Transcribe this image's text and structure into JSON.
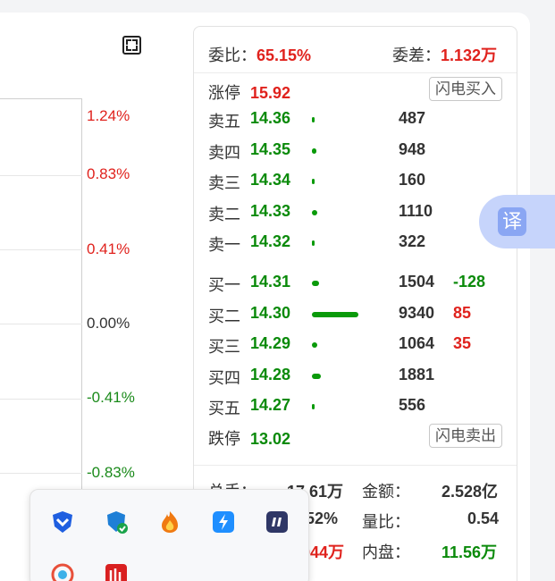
{
  "chart": {
    "pct_labels": [
      "1.24%",
      "0.83%",
      "0.41%",
      "0.00%",
      "-0.41%",
      "-0.83%"
    ]
  },
  "summary": {
    "weibi_label": "委比：",
    "weibi_value": "65.15%",
    "weicha_label": "委差：",
    "weicha_value": "1.132万"
  },
  "limit_up": {
    "label": "涨停",
    "value": "15.92",
    "button": "闪电买入"
  },
  "limit_down": {
    "label": "跌停",
    "value": "13.02",
    "button": "闪电卖出"
  },
  "asks": [
    {
      "label": "卖五",
      "price": "14.36",
      "volume": "487",
      "change": "",
      "level": 0.05
    },
    {
      "label": "卖四",
      "price": "14.35",
      "volume": "948",
      "change": "",
      "level": 0.1
    },
    {
      "label": "卖三",
      "price": "14.34",
      "volume": "160",
      "change": "",
      "level": 0.02
    },
    {
      "label": "卖二",
      "price": "14.33",
      "volume": "1110",
      "change": "",
      "level": 0.12
    },
    {
      "label": "卖一",
      "price": "14.32",
      "volume": "322",
      "change": "",
      "level": 0.03
    }
  ],
  "bids": [
    {
      "label": "买一",
      "price": "14.31",
      "volume": "1504",
      "change": "-128",
      "change_color": "#0a8a0a",
      "level": 0.16
    },
    {
      "label": "买二",
      "price": "14.30",
      "volume": "9340",
      "change": "85",
      "change_color": "#e0221d",
      "level": 1.0
    },
    {
      "label": "买三",
      "price": "14.29",
      "volume": "1064",
      "change": "35",
      "change_color": "#e0221d",
      "level": 0.11
    },
    {
      "label": "买四",
      "price": "14.28",
      "volume": "1881",
      "change": "",
      "change_color": "#333333",
      "level": 0.2
    },
    {
      "label": "买五",
      "price": "14.27",
      "volume": "556",
      "change": "",
      "change_color": "#333333",
      "level": 0.06
    }
  ],
  "stats": {
    "zongshou_label": "总手：",
    "zongshou_value": "17.61万",
    "jine_label": "金额：",
    "jine_value": "2.528亿",
    "huanshou_value": ".52%",
    "liangbi_label": "量比：",
    "liangbi_value": "0.54",
    "waipan_value": "044万",
    "neipan_label": "内盘：",
    "neipan_value": "11.56万"
  },
  "translate_label": "译",
  "tray_icons": [
    "shield-blue-icon",
    "shield-check-icon",
    "flame-icon",
    "lightning-icon",
    "quote-icon",
    "app-circle-icon",
    "red-app-icon"
  ],
  "colors": {
    "up": "#e0221d",
    "down": "#0a8a0a",
    "bar": "#0a9a0a"
  }
}
